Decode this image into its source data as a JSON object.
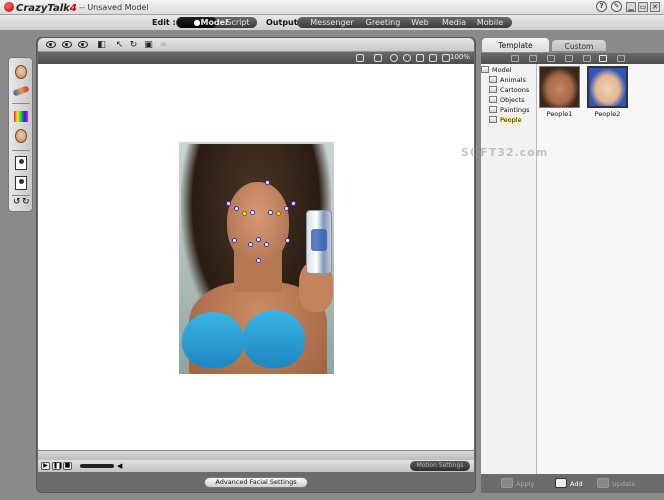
{
  "app": {
    "name": "CrazyTalk",
    "version": "4",
    "document_title": "-- Unsaved Model"
  },
  "titlebar": {
    "help_icon": "?",
    "tool_icon": "wand"
  },
  "menubar": {
    "edit_label": "Edit :",
    "edit_tabs": [
      "Model",
      "Script"
    ],
    "edit_active": "Model",
    "output_label": "Output :",
    "output_tabs": [
      "Messenger",
      "Greeting",
      "Web",
      "Media",
      "Mobile"
    ]
  },
  "viewport": {
    "zoom": "100%"
  },
  "playback": {
    "motion_settings": "Motion Settings"
  },
  "bottom": {
    "advanced_facial_settings": "Advanced Facial Settings"
  },
  "right_panel": {
    "tabs": [
      "Template",
      "Custom"
    ],
    "active_tab": "Template",
    "tree": {
      "root": "Model",
      "items": [
        "Animals",
        "Cartoons",
        "Objects",
        "Paintings",
        "People"
      ],
      "selected": "People"
    },
    "thumbnails": [
      {
        "label": "People1"
      },
      {
        "label": "People2"
      }
    ],
    "watermark": "SOFT32.com",
    "actions": {
      "apply": "Apply",
      "add": "Add",
      "update": "Update"
    }
  },
  "colors": {
    "accent": "#3a2bd8",
    "bikini": "#2a9fd8",
    "selection": "#fff8a8"
  }
}
